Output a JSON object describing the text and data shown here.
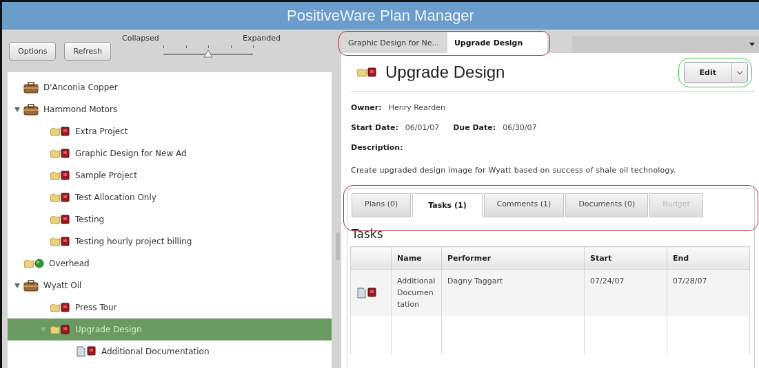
{
  "window": {
    "title": "PositiveWare Plan Manager"
  },
  "toolbar": {
    "buttons": [
      "Options",
      "Refresh"
    ],
    "slider": {
      "min_label": "Collapsed",
      "max_label": "Expanded",
      "level": 0.5
    }
  },
  "tree": [
    {
      "kind": "client",
      "label": "D'Anconia Copper",
      "selected": false
    },
    {
      "kind": "client",
      "label": "Hammond Motors",
      "selected": false,
      "expanded": true,
      "children": [
        {
          "kind": "project",
          "label": "Extra Project",
          "selected": false
        },
        {
          "kind": "project",
          "label": "Graphic Design for New Ad",
          "selected": false
        },
        {
          "kind": "project",
          "label": "Sample Project",
          "selected": false
        },
        {
          "kind": "project",
          "label": "Test Allocation Only",
          "selected": false
        },
        {
          "kind": "project",
          "label": "Testing",
          "selected": false
        },
        {
          "kind": "project",
          "label": "Testing hourly project billing",
          "selected": false
        }
      ]
    },
    {
      "kind": "overhead",
      "label": "Overhead",
      "selected": false
    },
    {
      "kind": "client",
      "label": "Wyatt Oil",
      "selected": false,
      "expanded": true,
      "children": [
        {
          "kind": "project",
          "label": "Press Tour",
          "selected": false
        },
        {
          "kind": "project",
          "label": "Upgrade Design",
          "selected": true,
          "expanded": true,
          "children": [
            {
              "kind": "task",
              "label": "Additional Documentation",
              "selected": false
            }
          ]
        }
      ]
    }
  ],
  "doc_tabs": {
    "outlined": true,
    "tabs": [
      {
        "label": "Graphic Design for Ne...",
        "selected": false
      },
      {
        "label": "Upgrade Design",
        "selected": true
      }
    ]
  },
  "detail": {
    "kind": "project",
    "title": "Upgrade Design",
    "edit_button": "Edit",
    "edit_outlined": true,
    "fields": [
      [
        {
          "label": "Owner:",
          "value": "Henry Rearden"
        }
      ],
      [
        {
          "label": "Start Date:",
          "value": "06/01/07"
        },
        {
          "label": "Due Date:",
          "value": "06/30/07"
        }
      ]
    ],
    "description_label": "Description:",
    "description": "Create upgraded design image for Wyatt based on success of shale oil technology."
  },
  "section_tabs": {
    "outlined": true,
    "tabs": [
      {
        "label": "Plans (0)",
        "selected": false,
        "disabled": false
      },
      {
        "label": "Tasks (1)",
        "selected": true,
        "disabled": false
      },
      {
        "label": "Comments (1)",
        "selected": false,
        "disabled": false
      },
      {
        "label": "Documents (0)",
        "selected": false,
        "disabled": false
      },
      {
        "label": "Budget",
        "selected": false,
        "disabled": true
      }
    ]
  },
  "tasks": {
    "heading": "Tasks",
    "columns": [
      "Name",
      "Performer",
      "Start",
      "End"
    ],
    "rows": [
      {
        "kind": "task",
        "cells": [
          "Additional Documentation",
          "Dagny Taggart",
          "07/24/07",
          "07/28/07"
        ]
      }
    ]
  }
}
